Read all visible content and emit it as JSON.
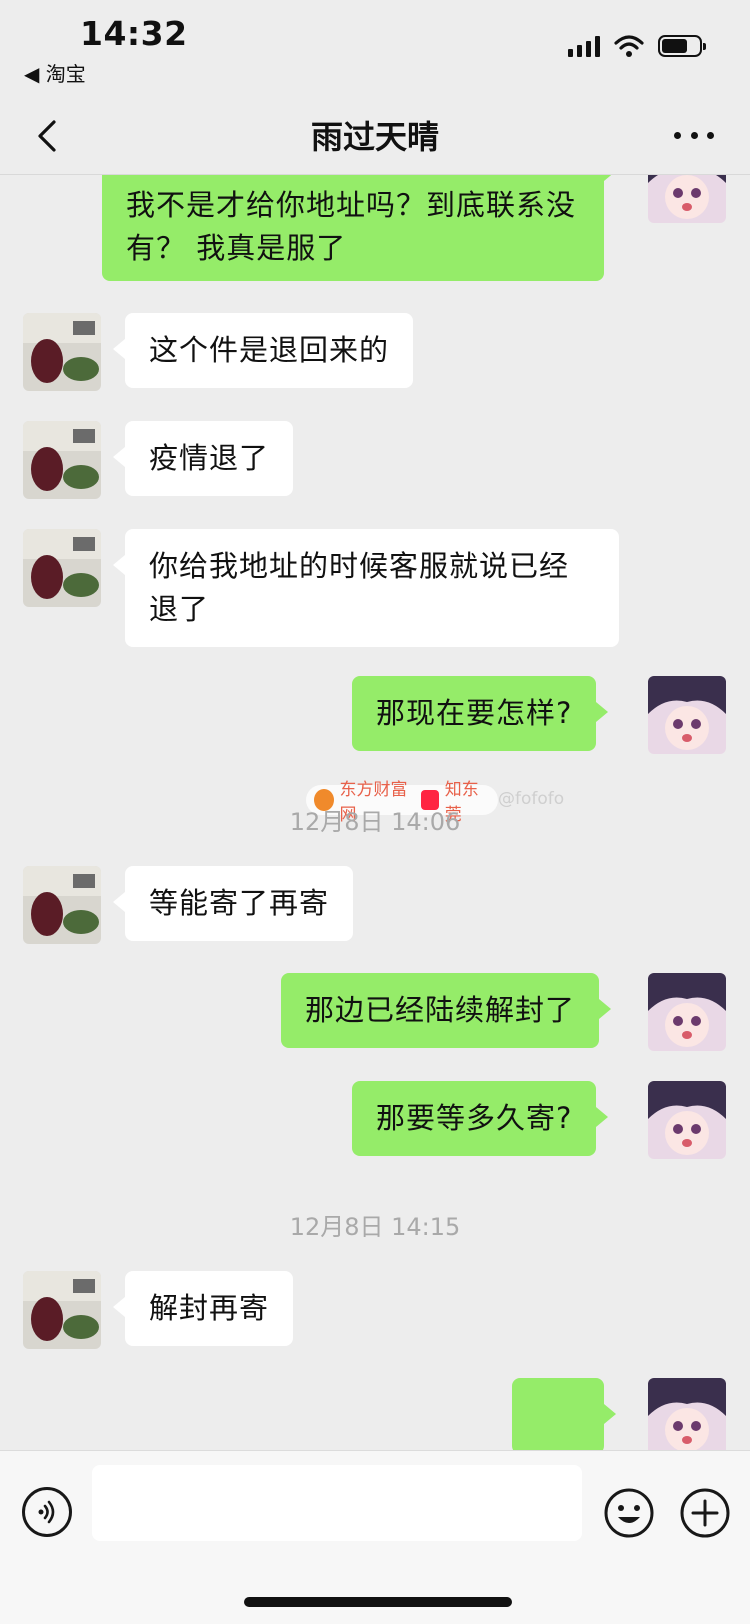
{
  "status_bar": {
    "time": "14:32",
    "back_app": "◀ 淘宝",
    "battery_level": 0.7
  },
  "nav": {
    "title": "雨过天晴"
  },
  "messages": [
    {
      "side": "out",
      "text": "搞什么啊？给我发快递的么咖了？ 我不是才给你地址吗？到底联系没有？ 我真是服了"
    },
    {
      "side": "in",
      "text": "这个件是退回来的"
    },
    {
      "side": "in",
      "text": "疫情退了"
    },
    {
      "side": "in",
      "text": "你给我地址的时候客服就说已经退了"
    },
    {
      "side": "out",
      "text": "那现在要怎样?"
    },
    {
      "type": "timestamp",
      "text": "12月8日 14:06"
    },
    {
      "side": "in",
      "text": "等能寄了再寄"
    },
    {
      "side": "out",
      "text": "那边已经陆续解封了"
    },
    {
      "side": "out",
      "text": "那要等多久寄?"
    },
    {
      "type": "timestamp",
      "text": "12月8日 14:15"
    },
    {
      "side": "in",
      "text": "解封再寄"
    },
    {
      "side": "out",
      "text": ""
    }
  ],
  "watermark": {
    "left_text": "东方财富网",
    "right_text": "知东莞",
    "tail_text": "@fofofo"
  },
  "input": {
    "value": "",
    "placeholder": ""
  },
  "icons": {
    "back": "chevron-left-icon",
    "more": "more-dots-icon",
    "voice": "voice-icon",
    "emoji": "emoji-icon",
    "plus": "plus-icon",
    "signal": "signal-icon",
    "wifi": "wifi-icon",
    "battery": "battery-icon"
  },
  "colors": {
    "background": "#ededed",
    "bubble_out": "#95ec69",
    "bubble_in": "#ffffff",
    "timestamp": "#a9a9a9"
  }
}
